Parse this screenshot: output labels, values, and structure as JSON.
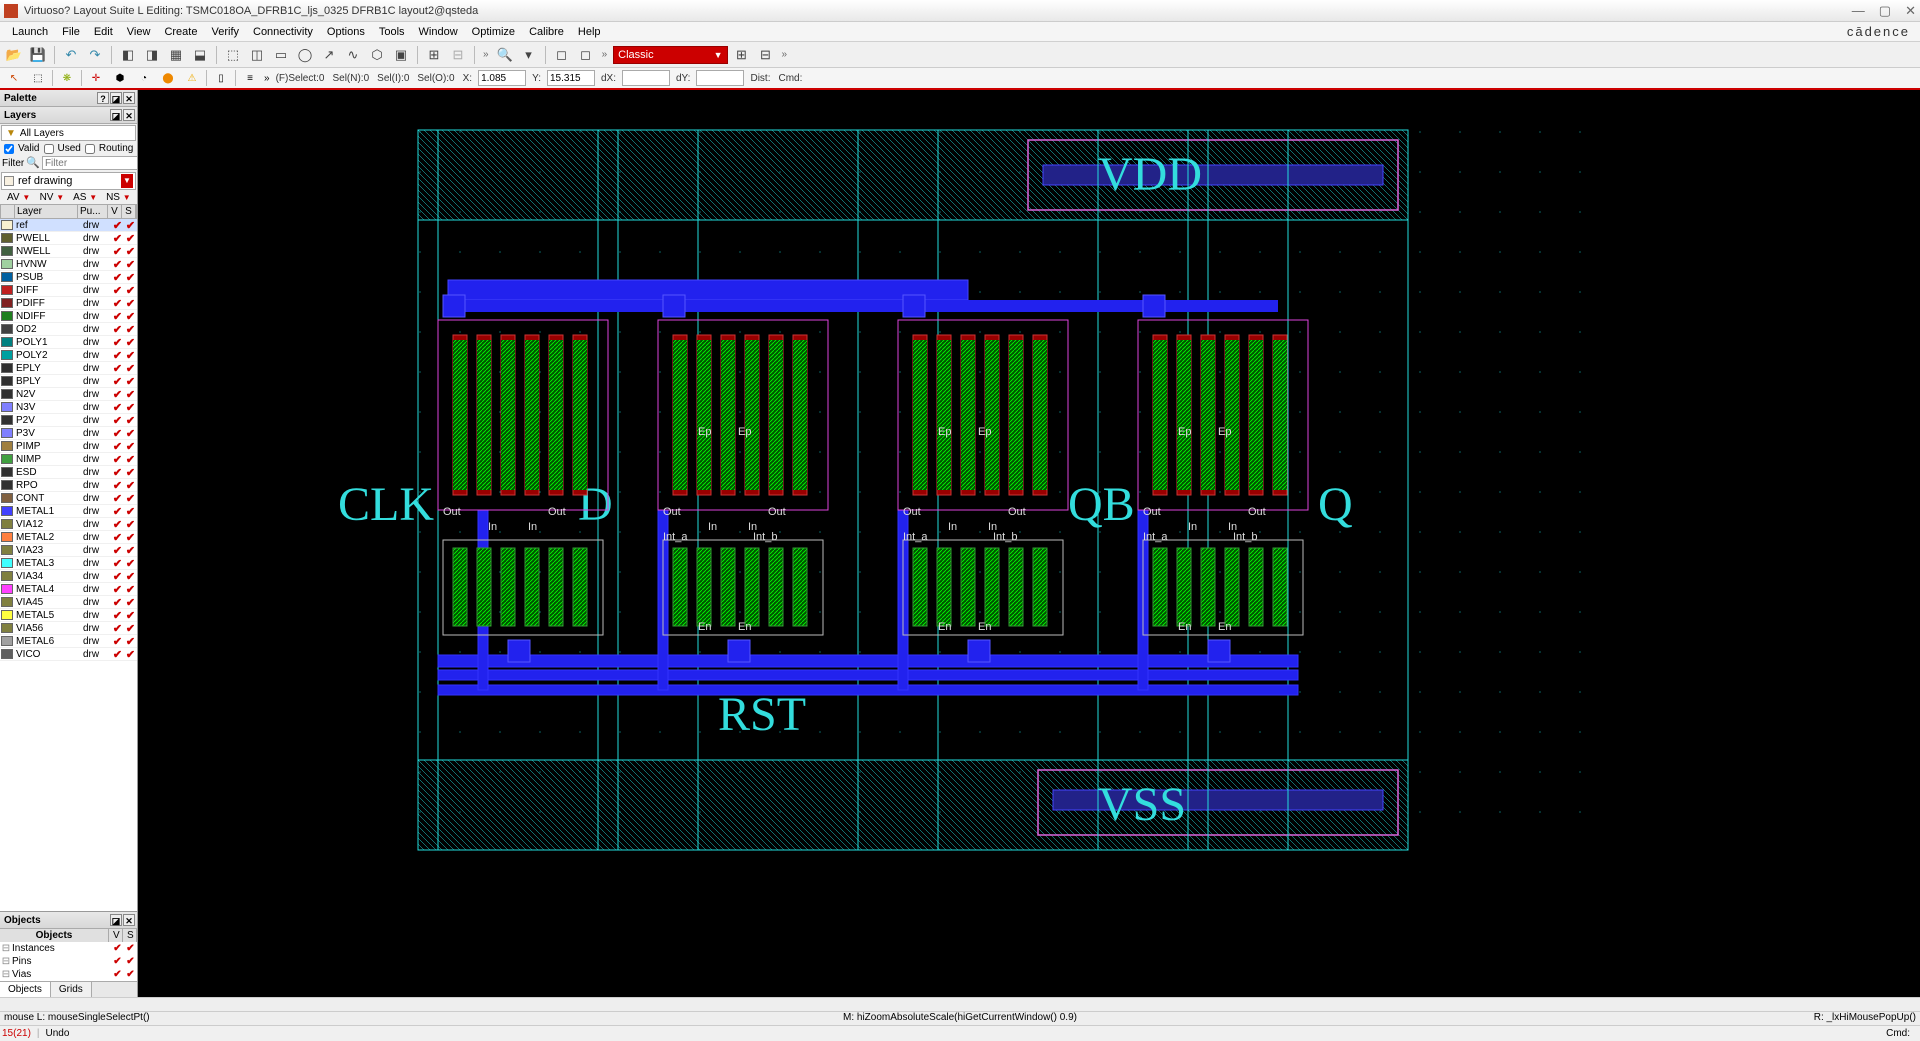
{
  "title": "Virtuoso? Layout Suite L Editing: TSMC018OA_DFRB1C_ljs_0325 DFRB1C layout2@qsteda",
  "brand": "cādence",
  "menu": [
    "Launch",
    "File",
    "Edit",
    "View",
    "Create",
    "Verify",
    "Connectivity",
    "Options",
    "Tools",
    "Window",
    "Optimize",
    "Calibre",
    "Help"
  ],
  "toolbox": {
    "label": "Classic"
  },
  "selbar": {
    "fsel": "(F)Select:0",
    "seln": "Sel(N):0",
    "seli": "Sel(I):0",
    "selo": "Sel(O):0",
    "xlbl": "X:",
    "xval": "1.085",
    "ylbl": "Y:",
    "yval": "15.315",
    "dxlbl": "dX:",
    "dxval": "",
    "dylbl": "dY:",
    "dyval": "",
    "dist": "Dist:",
    "cmd": "Cmd:"
  },
  "palette": {
    "title": "Palette",
    "layersTitle": "Layers",
    "allLayers": "All Layers",
    "valid": "Valid",
    "used": "Used",
    "routing": "Routing",
    "filterLbl": "Filter",
    "filterPlaceholder": "Filter",
    "refDrawing": "ref drawing",
    "av": "AV",
    "nv": "NV",
    "as": "AS",
    "ns": "NS",
    "hdrLayer": "Layer",
    "hdrPu": "Pu...",
    "hdrV": "V",
    "hdrS": "S"
  },
  "layers": [
    {
      "n": "ref",
      "p": "drw",
      "c": "#f8f0d0",
      "sel": true
    },
    {
      "n": "PWELL",
      "p": "drw",
      "c": "#606030"
    },
    {
      "n": "NWELL",
      "p": "drw",
      "c": "#406040"
    },
    {
      "n": "HVNW",
      "p": "drw",
      "c": "#a0d0a0"
    },
    {
      "n": "PSUB",
      "p": "drw",
      "c": "#0060a0"
    },
    {
      "n": "DIFF",
      "p": "drw",
      "c": "#c02020"
    },
    {
      "n": "PDIFF",
      "p": "drw",
      "c": "#802020"
    },
    {
      "n": "NDIFF",
      "p": "drw",
      "c": "#208020"
    },
    {
      "n": "OD2",
      "p": "drw",
      "c": "#404040"
    },
    {
      "n": "POLY1",
      "p": "drw",
      "c": "#008080"
    },
    {
      "n": "POLY2",
      "p": "drw",
      "c": "#00a0a0"
    },
    {
      "n": "EPLY",
      "p": "drw",
      "c": "#303030"
    },
    {
      "n": "BPLY",
      "p": "drw",
      "c": "#303030"
    },
    {
      "n": "N2V",
      "p": "drw",
      "c": "#303030"
    },
    {
      "n": "N3V",
      "p": "drw",
      "c": "#8080ff"
    },
    {
      "n": "P2V",
      "p": "drw",
      "c": "#303030"
    },
    {
      "n": "P3V",
      "p": "drw",
      "c": "#8080ff"
    },
    {
      "n": "PIMP",
      "p": "drw",
      "c": "#a08040"
    },
    {
      "n": "NIMP",
      "p": "drw",
      "c": "#40a040"
    },
    {
      "n": "ESD",
      "p": "drw",
      "c": "#303030"
    },
    {
      "n": "RPO",
      "p": "drw",
      "c": "#303030"
    },
    {
      "n": "CONT",
      "p": "drw",
      "c": "#806040"
    },
    {
      "n": "METAL1",
      "p": "drw",
      "c": "#4040ff"
    },
    {
      "n": "VIA12",
      "p": "drw",
      "c": "#808040"
    },
    {
      "n": "METAL2",
      "p": "drw",
      "c": "#ff8040"
    },
    {
      "n": "VIA23",
      "p": "drw",
      "c": "#808040"
    },
    {
      "n": "METAL3",
      "p": "drw",
      "c": "#40ffff"
    },
    {
      "n": "VIA34",
      "p": "drw",
      "c": "#808040"
    },
    {
      "n": "METAL4",
      "p": "drw",
      "c": "#ff40ff"
    },
    {
      "n": "VIA45",
      "p": "drw",
      "c": "#808040"
    },
    {
      "n": "METAL5",
      "p": "drw",
      "c": "#ffff40"
    },
    {
      "n": "VIA56",
      "p": "drw",
      "c": "#808040"
    },
    {
      "n": "METAL6",
      "p": "drw",
      "c": "#a0a0a0"
    },
    {
      "n": "VICO",
      "p": "drw",
      "c": "#606060"
    }
  ],
  "objects": {
    "title": "Objects",
    "hdr": "Objects",
    "hdrV": "V",
    "hdrS": "S",
    "items": [
      "Instances",
      "Pins",
      "Vias"
    ]
  },
  "bottomTabs": [
    "Objects",
    "Grids"
  ],
  "canvas": {
    "bigLabels": [
      "VDD",
      "CLK",
      "D",
      "QB",
      "Q",
      "RST",
      "VSS"
    ],
    "pinLabels": [
      "Out",
      "In",
      "Ep",
      "En",
      "Int_a",
      "Int_b"
    ]
  },
  "mousebar": {
    "l": "mouse L: mouseSingleSelectPt()",
    "m": "M: hiZoomAbsoluteScale(hiGetCurrentWindow() 0.9)",
    "r": "R: _lxHiMousePopUp()"
  },
  "status": {
    "num": "15(21)",
    "undo": "Undo",
    "cmd": "Cmd:"
  }
}
